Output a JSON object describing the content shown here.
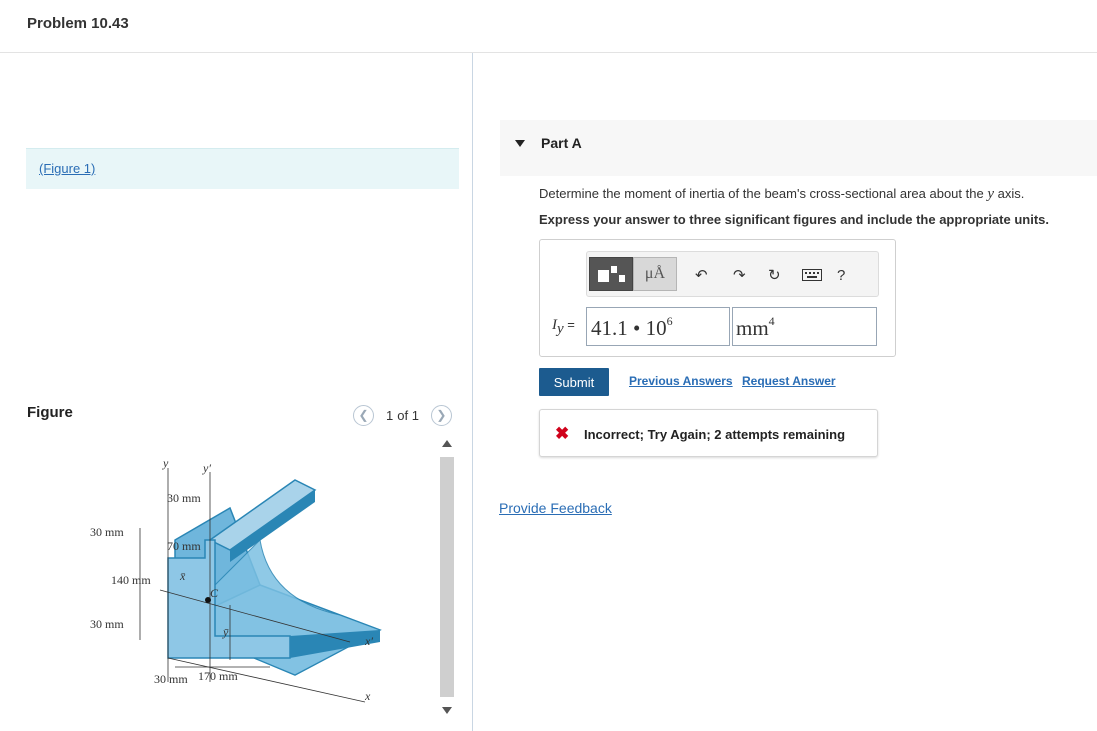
{
  "problem": {
    "title": "Problem 10.43"
  },
  "figure_link": {
    "label": "(Figure 1)"
  },
  "figure": {
    "heading": "Figure",
    "pager": {
      "current": "1",
      "of_label": "of 1"
    },
    "labels": {
      "y": "y",
      "y_prime": "y′",
      "x": "x",
      "x_prime": "x′",
      "centroid": "C",
      "x_bar": "x̄",
      "y_bar": "ȳ",
      "dim_30_top": "30 mm",
      "dim_70": "70 mm",
      "dim_30_left_top": "30 mm",
      "dim_140": "140 mm",
      "dim_30_left_bottom": "30 mm",
      "dim_30_bottom": "30 mm",
      "dim_170": "170 mm"
    }
  },
  "part": {
    "label": "Part A"
  },
  "question": {
    "text": "Determine the moment of inertia of the beam's cross-sectional area about the",
    "axis": "y",
    "suffix": "axis.",
    "instruction": "Express your answer to three significant figures and include the appropriate units."
  },
  "toolbar": {
    "template_icon": "template-icon",
    "units_label": "μÅ",
    "undo_icon": "undo-icon",
    "redo_icon": "redo-icon",
    "reset_icon": "reset-icon",
    "keyboard_icon": "keyboard-icon",
    "help_label": "?"
  },
  "answer": {
    "variable": "I",
    "variable_sub": "y",
    "equals": "=",
    "value_mantissa": "41.1 • 10",
    "value_exponent": "6",
    "unit_base": "mm",
    "unit_exponent": "4"
  },
  "actions": {
    "submit": "Submit",
    "previous_answers": "Previous Answers",
    "request_answer": "Request Answer"
  },
  "feedback": {
    "icon": "x-mark-icon",
    "message": "Incorrect; Try Again; 2 attempts remaining"
  },
  "provide_feedback": "Provide Feedback",
  "colors": {
    "submit_bg": "#1c5b8f",
    "link": "#2a6db5",
    "error": "#d0021b",
    "figure_fill": "#a9d3ea",
    "figure_edge": "#2a86b5"
  }
}
